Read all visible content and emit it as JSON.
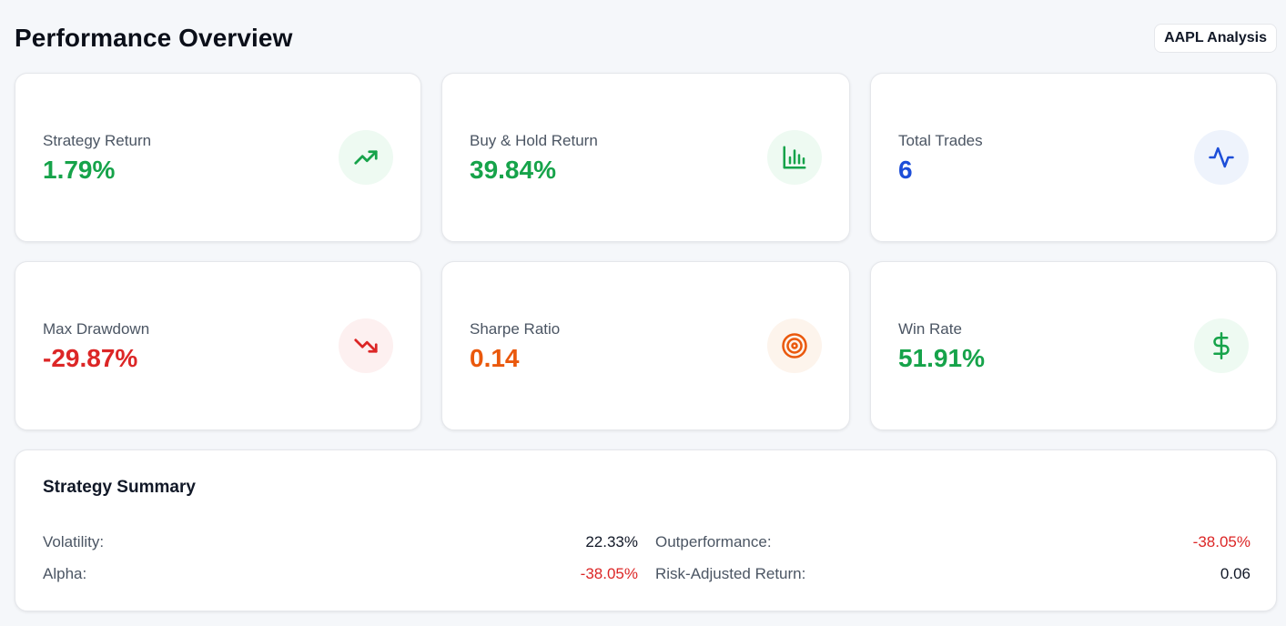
{
  "header": {
    "title": "Performance Overview",
    "symbol": "AAPL Analysis"
  },
  "cards": [
    {
      "label": "Strategy Return",
      "value": "1.79%",
      "icon": "trending-up-icon",
      "color": "#16a34a",
      "bg": "#eefaf2"
    },
    {
      "label": "Buy & Hold Return",
      "value": "39.84%",
      "icon": "bar-chart-icon",
      "color": "#16a34a",
      "bg": "#eefaf2"
    },
    {
      "label": "Total Trades",
      "value": "6",
      "icon": "activity-icon",
      "color": "#1d4ed8",
      "bg": "#eef3fc"
    },
    {
      "label": "Max Drawdown",
      "value": "-29.87%",
      "icon": "trending-down-icon",
      "color": "#dc2626",
      "bg": "#fdf0f0"
    },
    {
      "label": "Sharpe Ratio",
      "value": "0.14",
      "icon": "target-icon",
      "color": "#ea580c",
      "bg": "#fdf4ec"
    },
    {
      "label": "Win Rate",
      "value": "51.91%",
      "icon": "dollar-icon",
      "color": "#16a34a",
      "bg": "#eefaf2"
    }
  ],
  "summary": {
    "title": "Strategy Summary",
    "items": [
      {
        "label": "Volatility:",
        "value": "22.33%",
        "color": "#111827"
      },
      {
        "label": "Outperformance:",
        "value": "-38.05%",
        "color": "#dc2626"
      },
      {
        "label": "Alpha:",
        "value": "-38.05%",
        "color": "#dc2626"
      },
      {
        "label": "Risk-Adjusted Return:",
        "value": "0.06",
        "color": "#111827"
      }
    ]
  }
}
